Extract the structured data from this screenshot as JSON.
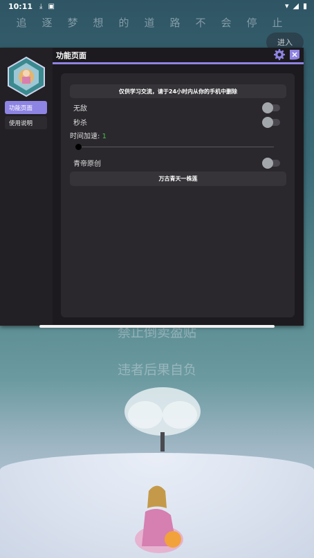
{
  "status_bar": {
    "time": "10:11",
    "left_icons": [
      "download-icon",
      "notification-a-icon"
    ],
    "right_icons": [
      "wifi-icon",
      "signal-icon",
      "battery-icon"
    ]
  },
  "background": {
    "poem": "追逐梦想的道路不会停止",
    "enter_button": "进入",
    "line1": "禁止倒卖盈贴",
    "line2": "违者后果自负"
  },
  "menu": {
    "title": "功能页面",
    "sidebar": {
      "tabs": [
        {
          "label": "功能页面",
          "active": true
        },
        {
          "label": "使用说明",
          "active": false
        }
      ]
    },
    "notice": "仅供学习交流，请于24小时内从你的手机中删除",
    "toggles": [
      {
        "label": "无敌",
        "on": false
      },
      {
        "label": "秒杀",
        "on": false
      },
      {
        "label": "青帝原创",
        "on": false
      }
    ],
    "slider": {
      "label": "时间加速: ",
      "value": "1",
      "position": 0
    },
    "footer": "万古青天一株莲"
  },
  "colors": {
    "accent": "#8f83e3",
    "panel_bg": "#1f1d21",
    "card_bg": "#2a282d",
    "value_green": "#4bc24b"
  }
}
